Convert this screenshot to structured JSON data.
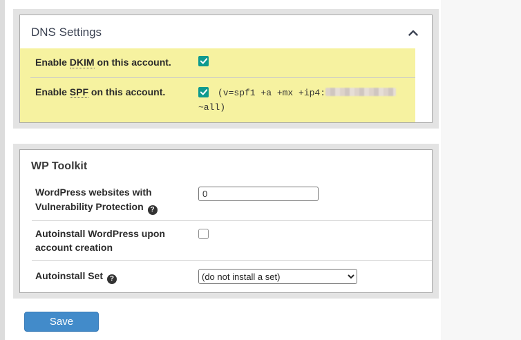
{
  "icons": {
    "help_glyph": "?"
  },
  "colors": {
    "highlight": "#f6f2a0",
    "checkbox_checked": "#0f9a8f",
    "save_button": "#428bca",
    "panel_title": "#3b4252"
  },
  "dns_panel": {
    "title": "DNS Settings",
    "collapsed": false,
    "rows": [
      {
        "label_prefix": "Enable ",
        "label_term": "DKIM",
        "label_suffix": " on this account.",
        "checked": true
      },
      {
        "label_prefix": "Enable ",
        "label_term": "SPF",
        "label_suffix": " on this account.",
        "checked": true,
        "value_prefix": "(v=spf1 +a +mx +ip4:",
        "value_ip_redacted": true,
        "value_suffix": "~all)"
      }
    ]
  },
  "wp_toolkit_panel": {
    "title": "WP Toolkit",
    "rows": [
      {
        "label": "WordPress websites with Vulnerability Protection",
        "has_help_icon": true,
        "control": "text-input",
        "value": "0"
      },
      {
        "label": "Autoinstall WordPress upon account creation",
        "control": "checkbox",
        "checked": false
      },
      {
        "label": "Autoinstall Set",
        "has_help_icon": true,
        "control": "select",
        "selected_option": "(do not install a set)"
      }
    ]
  },
  "actions": {
    "save_label": "Save"
  }
}
